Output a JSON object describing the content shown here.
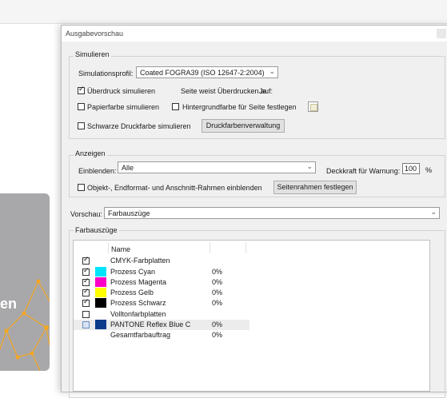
{
  "window": {
    "title": "Ausgabevorschau"
  },
  "background": {
    "card_text": "en"
  },
  "simulieren": {
    "group_label": "Simulieren",
    "profile_label": "Simulationsprofil:",
    "profile_value": "Coated FOGRA39 (ISO 12647-2:2004)",
    "overprint_label": "Überdruck simulieren",
    "overprint_checked": true,
    "page_overprint_label": "Seite weist Überdrucken auf:",
    "page_overprint_value": "Ja",
    "paper_color_label": "Papierfarbe simulieren",
    "bg_color_label": "Hintergrundfarbe für Seite festlegen",
    "black_ink_label": "Schwarze Druckfarbe simulieren",
    "ink_manager_button": "Druckfarbenverwaltung"
  },
  "anzeigen": {
    "group_label": "Anzeigen",
    "show_label": "Einblenden:",
    "show_value": "Alle",
    "opacity_label": "Deckkraft für Warnung:",
    "opacity_value": "100",
    "opacity_unit": "%",
    "frames_label": "Objekt-, Endformat- und Anschnitt-Rahmen einblenden",
    "page_frames_button": "Seitenrahmen festlegen"
  },
  "vorschau": {
    "label": "Vorschau:",
    "value": "Farbauszüge"
  },
  "farbauszuege": {
    "group_label": "Farbauszüge",
    "col_name": "Name",
    "rows": [
      {
        "name": "CMYK-Farbplatten",
        "checked": true,
        "swatch": "",
        "pct": ""
      },
      {
        "name": "Prozess Cyan",
        "checked": true,
        "swatch": "#00e5ff",
        "pct": "0%"
      },
      {
        "name": "Prozess Magenta",
        "checked": true,
        "swatch": "#ff00c8",
        "pct": "0%"
      },
      {
        "name": "Prozess Gelb",
        "checked": true,
        "swatch": "#ffff00",
        "pct": "0%"
      },
      {
        "name": "Prozess Schwarz",
        "checked": true,
        "swatch": "#000000",
        "pct": "0%"
      },
      {
        "name": "Volltonfarbplatten",
        "checked": false,
        "swatch": "",
        "pct": ""
      },
      {
        "name": "PANTONE Reflex Blue C",
        "checked": false,
        "swatch": "#0c3b8c",
        "pct": "0%"
      },
      {
        "name": "Gesamtfarbauftrag",
        "checked": false,
        "swatch": "",
        "pct": "0%"
      }
    ]
  },
  "colors": {
    "accent_orange": "#f5a623",
    "card_gray": "#a8a8aa",
    "dialog_bg": "#f0f0f0"
  }
}
